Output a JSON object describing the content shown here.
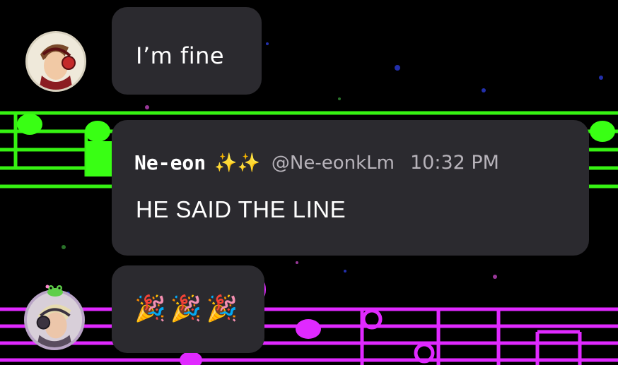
{
  "messages": [
    {
      "text": "I’m fine"
    },
    {
      "sender_name": "Ne-eon",
      "sender_sparkles": "✨✨",
      "handle": "@Ne-eonkLm",
      "time": "10:32 PM",
      "text": "HE SAID THE LINE"
    },
    {
      "text": "🎉🎉🎉"
    }
  ],
  "colors": {
    "background": "#000000",
    "bubble": "#2b2a2f",
    "green_staff": "#39ff14",
    "magenta_staff": "#e029ff",
    "secondary_text": "#b7b3ba"
  },
  "icons": [
    "avatar-red-headphones",
    "avatar-purple-headphones",
    "frog-badge",
    "sparkles",
    "party-popper"
  ]
}
